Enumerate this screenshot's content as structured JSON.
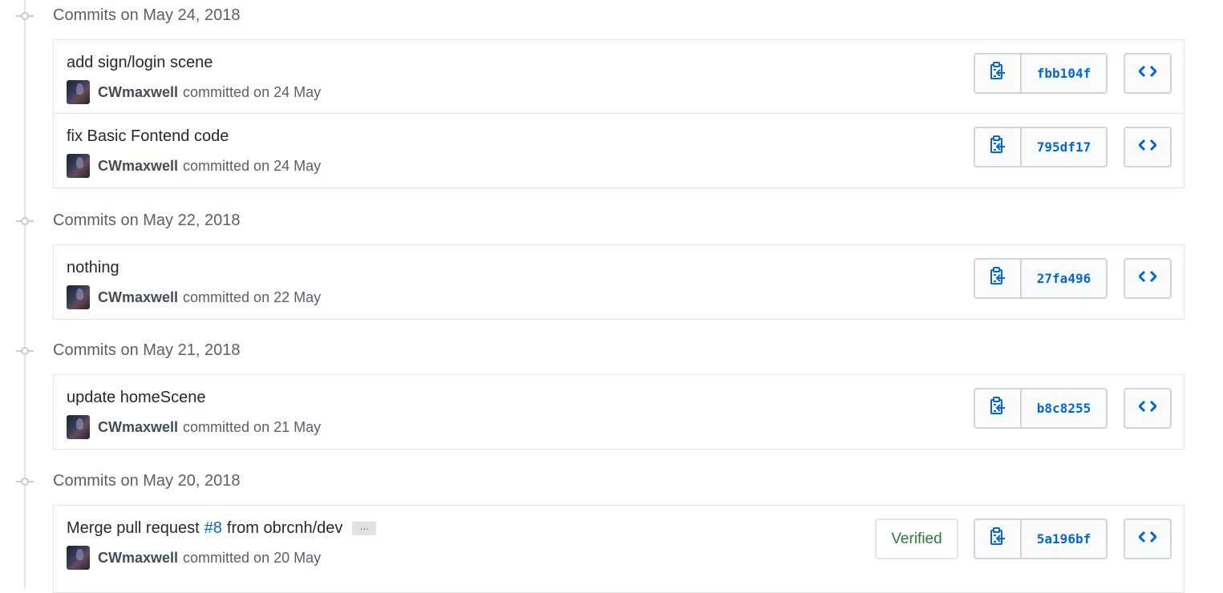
{
  "groups": [
    {
      "title": "Commits on May 24, 2018",
      "commits": [
        {
          "message": "add sign/login scene",
          "author": "CWmaxwell",
          "committed_text": "committed on 24 May",
          "sha": "fbb104f"
        },
        {
          "message": "fix Basic Fontend code",
          "author": "CWmaxwell",
          "committed_text": "committed on 24 May",
          "sha": "795df17"
        }
      ]
    },
    {
      "title": "Commits on May 22, 2018",
      "commits": [
        {
          "message": "nothing",
          "author": "CWmaxwell",
          "committed_text": "committed on 22 May",
          "sha": "27fa496"
        }
      ]
    },
    {
      "title": "Commits on May 21, 2018",
      "commits": [
        {
          "message": "update homeScene",
          "author": "CWmaxwell",
          "committed_text": "committed on 21 May",
          "sha": "b8c8255"
        }
      ]
    },
    {
      "title": "Commits on May 20, 2018",
      "commits": [
        {
          "message_prefix": "Merge pull request",
          "pr_number": "#8",
          "message_suffix": "from obrcnh/dev",
          "ellipsis": "…",
          "author": "CWmaxwell",
          "committed_text": "committed on 20 May",
          "sha": "5a196bf",
          "verified_label": "Verified"
        }
      ]
    }
  ],
  "icons": {
    "copy": "clippy-icon",
    "browse": "code-icon",
    "commit_node": "git-commit-icon"
  },
  "colors": {
    "link": "#0366d6",
    "verified": "#2b7a3b",
    "border": "#e1e4e8",
    "muted": "#586069"
  }
}
